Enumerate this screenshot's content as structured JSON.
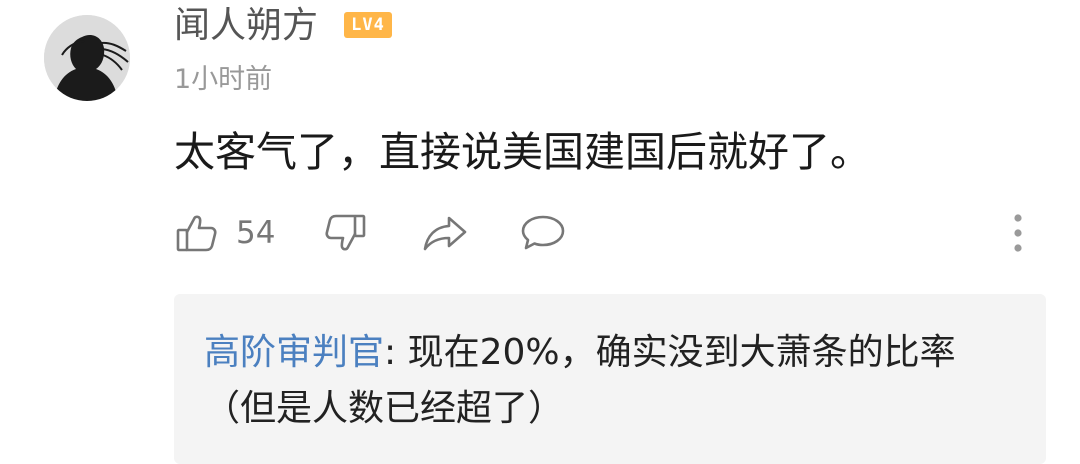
{
  "comment": {
    "username": "闻人朔方",
    "level": "LV4",
    "timestamp": "1小时前",
    "text": "太客气了，直接说美国建国后就好了。",
    "avatar_icon": "silhouette-avatar",
    "colors": {
      "username": "#555555",
      "level_badge": "#ffb648",
      "timestamp": "#999999",
      "text": "#1a1a1a",
      "reply_user": "#4b80c0",
      "reply_bg": "#f4f4f4"
    }
  },
  "actions": {
    "like_icon": "thumbs-up-icon",
    "like_count": "54",
    "dislike_icon": "thumbs-down-icon",
    "share_icon": "share-icon",
    "reply_icon": "comment-bubble-icon",
    "more_icon": "more-vertical-icon"
  },
  "reply": {
    "username": "高阶审判官",
    "separator": ": ",
    "text": "现在20%，确实没到大萧条的比率（但是人数已经超了）"
  }
}
